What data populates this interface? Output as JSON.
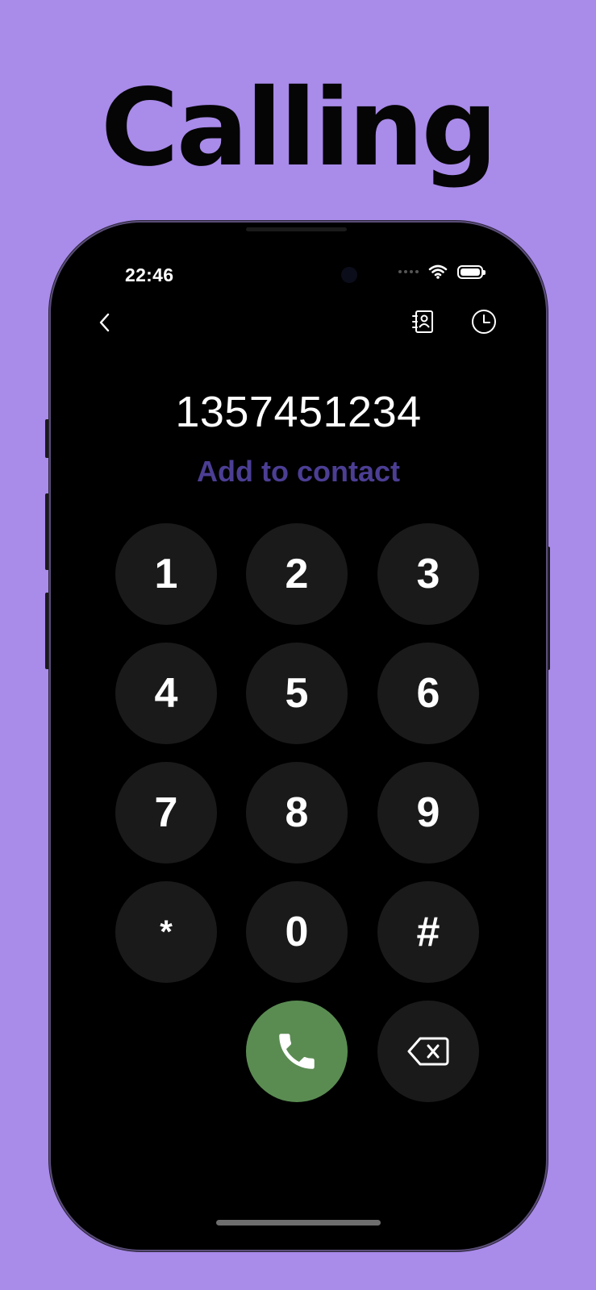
{
  "promo": {
    "title": "Calling"
  },
  "status_bar": {
    "time": "22:46"
  },
  "icons": {
    "back": "chevron-left-icon",
    "contacts": "contact-book-icon",
    "history": "clock-icon",
    "call": "phone-icon",
    "delete": "backspace-icon",
    "wifi": "wifi-icon",
    "battery": "battery-icon"
  },
  "dialer": {
    "number": "1357451234",
    "add_contact_label": "Add to contact",
    "keys": [
      "1",
      "2",
      "3",
      "4",
      "5",
      "6",
      "7",
      "8",
      "9",
      "*",
      "0",
      "#"
    ]
  },
  "colors": {
    "background": "#a98bea",
    "accent": "#4b3e93",
    "call_button": "#5a8c52",
    "key": "#1a1a1a"
  }
}
